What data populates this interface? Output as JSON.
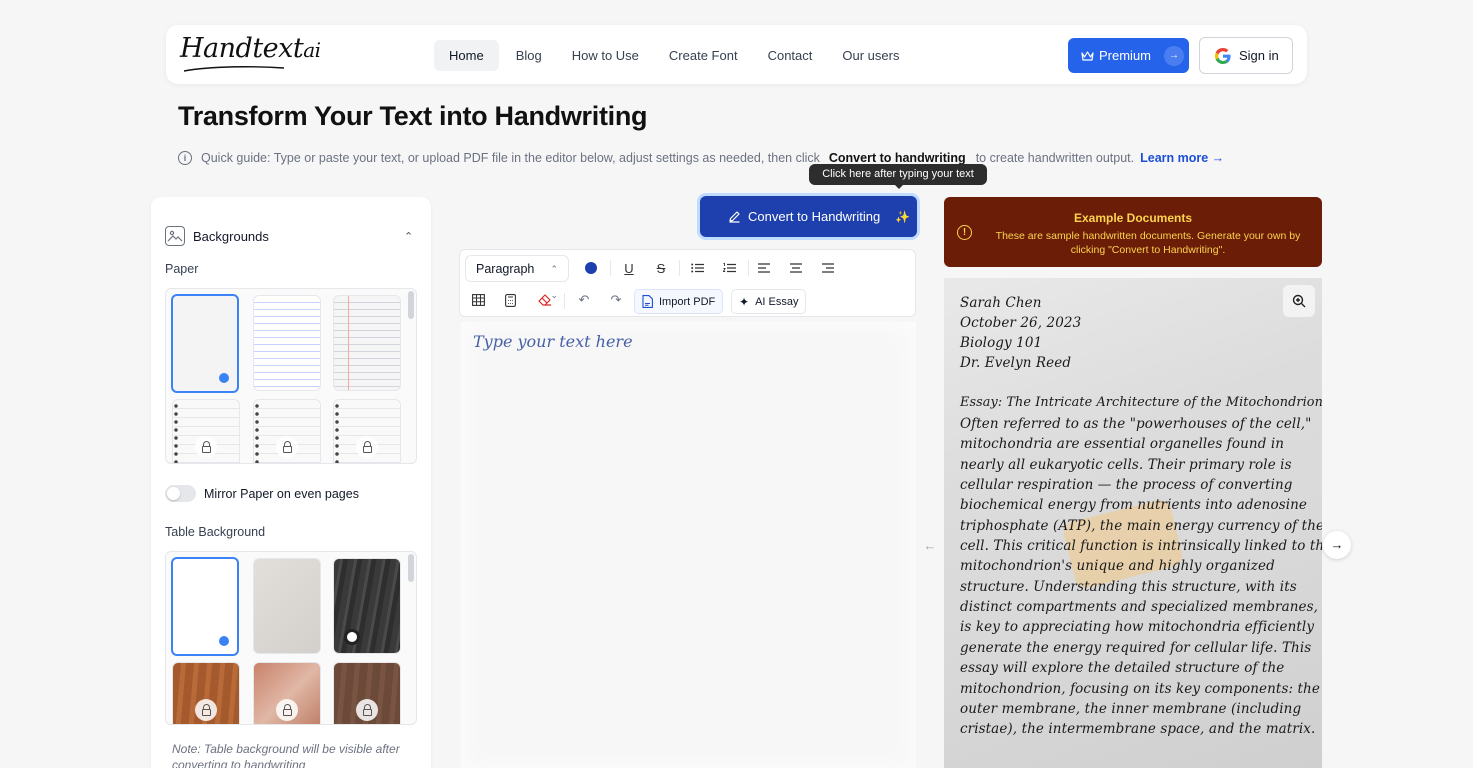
{
  "brand": {
    "logo_main": "Handtext",
    "logo_ai": "ai"
  },
  "nav": {
    "links": [
      "Home",
      "Blog",
      "How to Use",
      "Create Font",
      "Contact",
      "Our users"
    ],
    "premium_label": "Premium",
    "signin_label": "Sign in"
  },
  "hero": {
    "title": "Transform Your Text into Handwriting",
    "guide_text": "Quick guide: Type or paste your text, or upload PDF file in the editor below, adjust settings as needed, then click",
    "guide_strong": "Convert to handwriting",
    "guide_after": "to create handwritten output.",
    "learn_more": "Learn more →"
  },
  "settings": {
    "backgrounds_title": "Backgrounds",
    "paper_label": "Paper",
    "mirror_label": "Mirror Paper on even pages",
    "mirror_on": false,
    "table_bg_label": "Table Background",
    "note": "Note: Table background will be visible after converting to handwriting"
  },
  "editor": {
    "tooltip": "Click here after typing your text",
    "convert_label": "Convert to Handwriting",
    "paragraph_select": "Paragraph",
    "text_color": "#1e40af",
    "import_pdf": "Import PDF",
    "ai_essay": "AI Essay",
    "placeholder": "Type your text here"
  },
  "examples": {
    "title": "Example Documents",
    "description": "These are sample handwritten documents. Generate your own by clicking \"Convert to Handwriting\".",
    "document_lines": [
      "Sarah Chen",
      "October 26, 2023",
      "Biology 101",
      "Dr. Evelyn Reed",
      "Essay: The Intricate Architecture of the Mitochondrion",
      "Often referred to as the \"powerhouses of the cell,\"",
      "mitochondria are essential organelles found in",
      "nearly all eukaryotic cells. Their primary role is",
      "cellular respiration — the process of converting",
      "biochemical energy from nutrients into adenosine",
      "triphosphate (ATP), the main energy currency of the",
      "cell. This critical function is intrinsically linked to the",
      "mitochondrion's unique and highly organized",
      "structure. Understanding this structure, with its",
      "distinct compartments and specialized membranes,",
      "is key to appreciating how mitochondria efficiently",
      "generate the energy required for cellular life. This",
      "essay will explore the detailed structure of the",
      "mitochondrion, focusing on its key components: the",
      "outer membrane, the inner membrane (including",
      "cristae), the intermembrane space, and the matrix."
    ]
  }
}
